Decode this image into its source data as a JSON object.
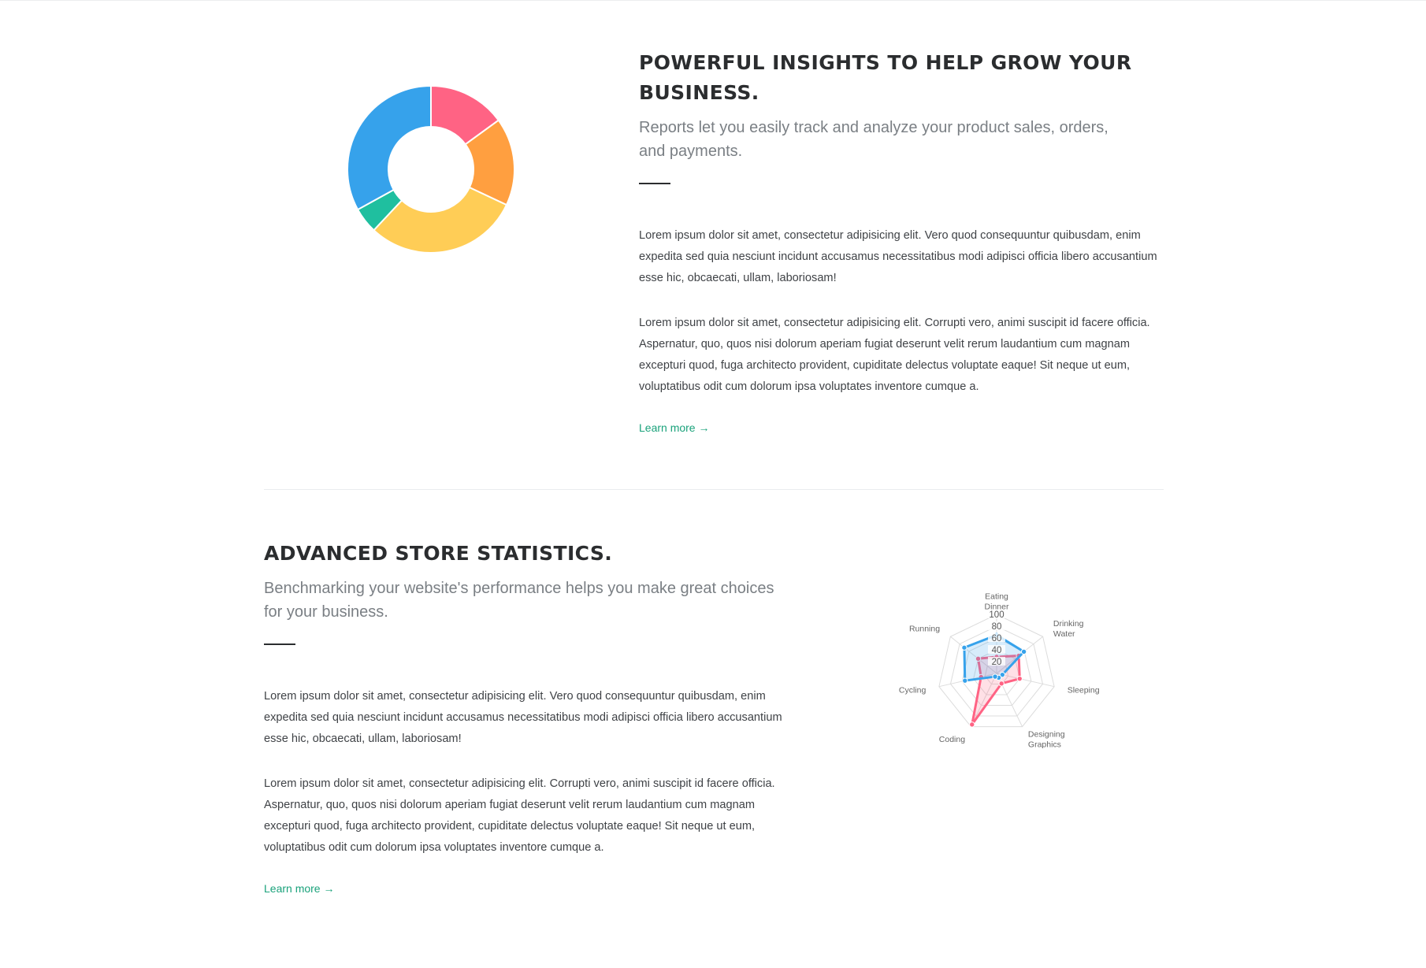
{
  "section1": {
    "title": "POWERFUL INSIGHTS TO HELP GROW YOUR BUSINESS.",
    "subtitle": "Reports let you easily track and analyze your product sales, orders, and payments.",
    "paragraphs": [
      "Lorem ipsum dolor sit amet, consectetur adipisicing elit. Vero quod consequuntur quibusdam, enim expedita sed quia nesciunt incidunt accusamus necessitatibus modi adipisci officia libero accusantium esse hic, obcaecati, ullam, laboriosam!",
      "Lorem ipsum dolor sit amet, consectetur adipisicing elit. Corrupti vero, animi suscipit id facere officia. Aspernatur, quo, quos nisi dolorum aperiam fugiat deserunt velit rerum laudantium cum magnam excepturi quod, fuga architecto provident, cupiditate delectus voluptate eaque! Sit neque ut eum, voluptatibus odit cum dolorum ipsa voluptates inventore cumque a."
    ],
    "learn_more": "Learn more →"
  },
  "section2": {
    "title": "ADVANCED STORE STATISTICS.",
    "subtitle": "Benchmarking your website's performance helps you make great choices for your business.",
    "paragraphs": [
      "Lorem ipsum dolor sit amet, consectetur adipisicing elit. Vero quod consequuntur quibusdam, enim expedita sed quia nesciunt incidunt accusamus necessitatibus modi adipisci officia libero accusantium esse hic, obcaecati, ullam, laboriosam!",
      "Lorem ipsum dolor sit amet, consectetur adipisicing elit. Corrupti vero, animi suscipit id facere officia. Aspernatur, quo, quos nisi dolorum aperiam fugiat deserunt velit rerum laudantium cum magnam excepturi quod, fuga architecto provident, cupiditate delectus voluptate eaque! Sit neque ut eum, voluptatibus odit cum dolorum ipsa voluptates inventore cumque a."
    ],
    "learn_more": "Learn more →"
  },
  "colors": {
    "accent_link": "#1aa27b",
    "heading": "#2b2d2f"
  },
  "chart_data": [
    {
      "type": "pie",
      "variant": "doughnut",
      "title": "",
      "categories": [
        "",
        "",
        "",
        "",
        ""
      ],
      "values": [
        15,
        17,
        30,
        5,
        33
      ],
      "colors": [
        "#ff6384",
        "#ff9f40",
        "#ffcd56",
        "#1fbf9f",
        "#36a2eb"
      ],
      "legend": "none"
    },
    {
      "type": "radar",
      "title": "",
      "categories": [
        [
          "Eating",
          "Dinner"
        ],
        [
          "Drinking",
          "Water"
        ],
        [
          "Sleeping"
        ],
        [
          "Designing",
          "Graphics"
        ],
        [
          "Coding"
        ],
        [
          "Cycling"
        ],
        [
          "Running"
        ]
      ],
      "ticks": [
        20,
        40,
        60,
        80,
        100
      ],
      "rlim": [
        0,
        100
      ],
      "series": [
        {
          "values": [
            28,
            48,
            40,
            19,
            96,
            27,
            40
          ],
          "color": "#ff6384",
          "fill": "rgba(255,99,132,0.2)"
        },
        {
          "values": [
            65,
            59,
            10,
            8,
            6,
            55,
            70
          ],
          "color": "#36a2eb",
          "fill": "rgba(54,162,235,0.2)"
        }
      ],
      "legend": "none"
    }
  ]
}
